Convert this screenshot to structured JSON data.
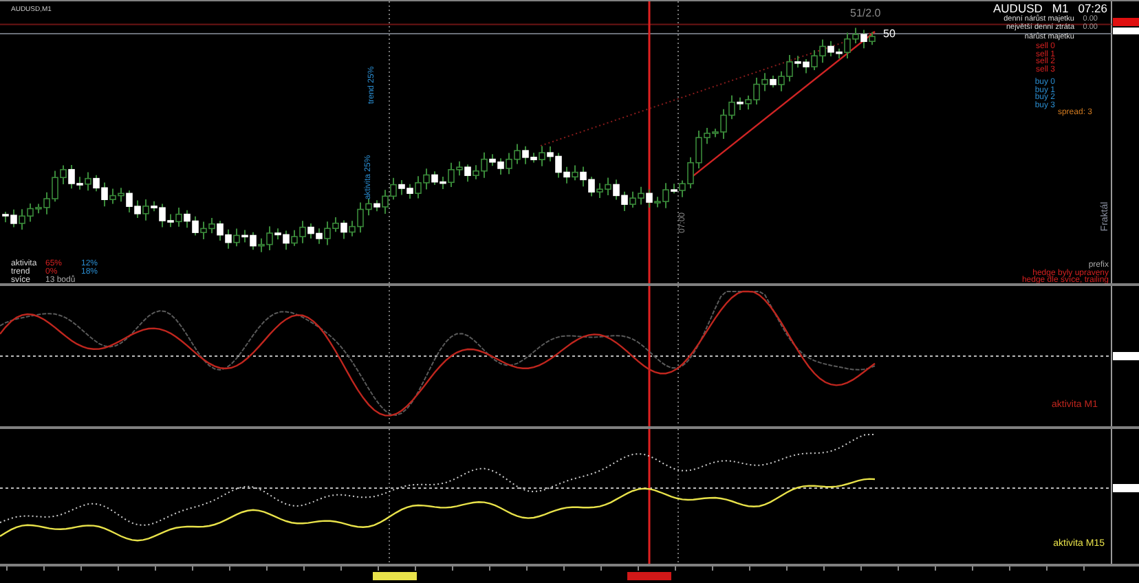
{
  "main_chart": {
    "title": "AUDUSD,M1",
    "symbol": "AUDUSD",
    "timeframe": "M1",
    "time": "07:26",
    "account": [
      {
        "label": "denní nárůst majetku",
        "value": "0.00"
      },
      {
        "label": "největší denní ztráta",
        "value": "0.00"
      },
      {
        "label": "nárůst majetku"
      }
    ],
    "sell_levels": [
      "sell 0",
      "sell 1",
      "sell 2",
      "sell 3"
    ],
    "buy_levels": [
      "buy 0",
      "buy 1",
      "buy 2",
      "buy 3"
    ],
    "spread": "spread: 3",
    "target_label": "51/2.0",
    "target_value": "50",
    "vertical_labels": [
      "trend 25%",
      "aktivita 25%"
    ],
    "time_marker": "07:00",
    "fractal_label": "Fraktál",
    "stats": [
      {
        "label": "aktivita",
        "value_1": "65%",
        "value_2": "12%"
      },
      {
        "label": "trend",
        "value_1": "0%",
        "value_2": "18%"
      },
      {
        "label": "svíce",
        "value_1": "13 bodů"
      }
    ],
    "notes": [
      {
        "text": "prefix",
        "kind": "info"
      },
      {
        "text": "hedge byly upraveny",
        "kind": "alert"
      },
      {
        "text": "hedge dle svíce, trailing",
        "kind": "alert"
      }
    ]
  },
  "indicators": [
    {
      "label": "aktivita M1",
      "color": "#c0261e"
    },
    {
      "label": "aktivita M15",
      "color": "#e8e24a"
    }
  ]
}
